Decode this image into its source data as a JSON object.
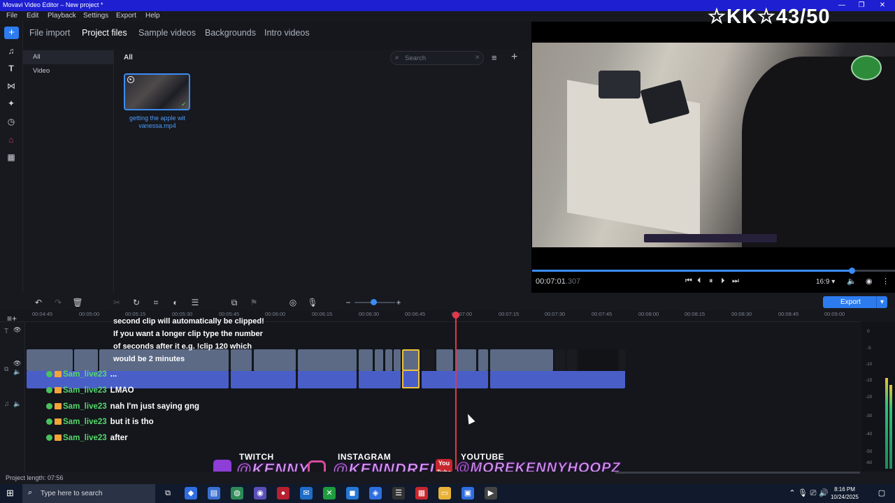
{
  "window": {
    "title": "Movavi Video Editor – New project *"
  },
  "menu": {
    "items": [
      "File",
      "Edit",
      "Playback",
      "Settings",
      "Export",
      "Help"
    ]
  },
  "sidebar": {
    "icons": [
      "add-icon",
      "music-icon",
      "text-icon",
      "transition-icon",
      "magic-wand-icon",
      "clock-icon",
      "sticker-icon",
      "more-tools-icon"
    ]
  },
  "tabs": [
    "File import",
    "Project files",
    "Sample videos",
    "Backgrounds",
    "Intro videos"
  ],
  "categories": {
    "header": "All",
    "items": [
      "All",
      "Video"
    ]
  },
  "files": {
    "header": "All",
    "search_placeholder": "Search",
    "item_name": "getting the apple wit vanessa.mp4"
  },
  "overlay": {
    "counter": "☆KK☆43/50"
  },
  "player": {
    "time": "00:07:01",
    "time_ms": ".307",
    "aspect": "16:9",
    "progress": 0.88
  },
  "toolbar": {
    "export_label": "Export"
  },
  "ruler": [
    "00:04:45",
    "00:05:00",
    "00:05:15",
    "00:05:30",
    "00:05:45",
    "00:06:00",
    "00:06:15",
    "00:06:30",
    "00:06:45",
    "00:07:00",
    "00:07:15",
    "00:07:30",
    "00:07:45",
    "00:08:00",
    "00:08:15",
    "00:08:30",
    "00:08:45",
    "00:09:00"
  ],
  "chat_overlay": {
    "top_lines": [
      "second clip will automatically be clipped!",
      "If you want a longer clip type the number",
      "of seconds after it e.g. !clip 120 which",
      "would be 2 minutes"
    ],
    "messages": [
      {
        "user": "Sam_live23",
        "text": "..."
      },
      {
        "user": "Sam_live23",
        "text": "LMAO"
      },
      {
        "user": "Sam_live23",
        "text": "nah I'm just saying gng"
      },
      {
        "user": "Sam_live23",
        "text": "but it is tho"
      },
      {
        "user": "Sam_live23",
        "text": "after"
      }
    ]
  },
  "socials": {
    "twitch_label": "TWITCH",
    "twitch_name": "@KENNY",
    "instagram_label": "INSTAGRAM",
    "instagram_name": "@KENNDRELL",
    "youtube_label": "YOUTUBE",
    "youtube_name": "@MOREKENNYHOOPZ",
    "youtube_icon_text": "You Tube"
  },
  "meter": {
    "labels": [
      "0",
      "-5",
      "-10",
      "-15",
      "-20",
      "-30",
      "-40",
      "-50",
      "-60"
    ]
  },
  "status": {
    "project_length": "Project length: 07:56"
  },
  "taskbar": {
    "search_placeholder": "Type here to search",
    "time": "8:16 PM",
    "date": "10/24/2025"
  }
}
